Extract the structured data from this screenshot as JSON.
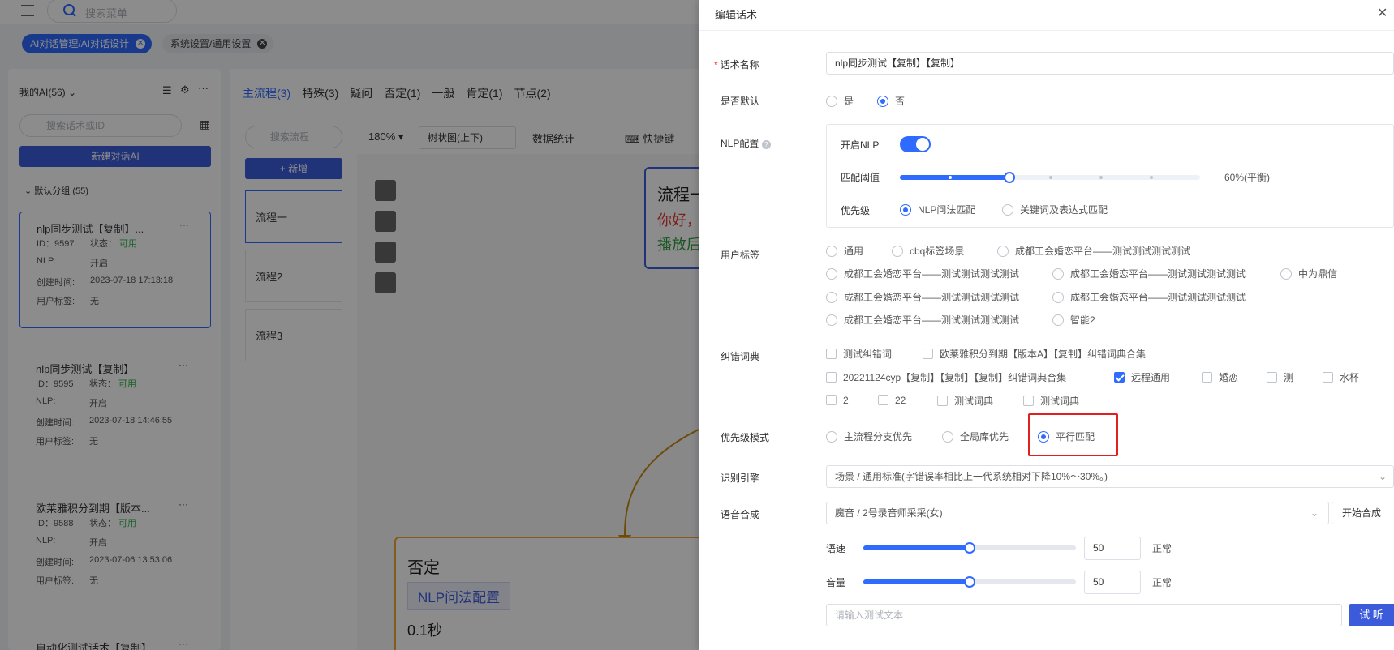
{
  "background": {
    "search_menu_placeholder": "搜索菜单",
    "tags": [
      "AI对话管理/AI对话设计",
      "系统设置/通用设置"
    ],
    "my_ai": "我的AI(56)",
    "script_search_placeholder": "搜索话术或ID",
    "new_ai_button": "新建对话AI",
    "default_group": "默认分组",
    "default_group_count": "(55)",
    "cards": [
      {
        "title": "nlp同步测试【复制】...",
        "id": "ID：9597",
        "status_label": "状态：",
        "status": "可用",
        "nlp_label": "NLP:",
        "nlp": "开启",
        "created_label": "创建时间:",
        "created": "2023-07-18 17:13:18",
        "tag_label": "用户标签:",
        "tag": "无"
      },
      {
        "title": "nlp同步测试【复制】",
        "id": "ID：9595",
        "status_label": "状态：",
        "status": "可用",
        "nlp_label": "NLP:",
        "nlp": "开启",
        "created_label": "创建时间:",
        "created": "2023-07-18 14:46:55",
        "tag_label": "用户标签:",
        "tag": "无"
      },
      {
        "title": "欧莱雅积分到期【版本...",
        "id": "ID：9588",
        "status_label": "状态：",
        "status": "可用",
        "nlp_label": "NLP:",
        "nlp": "开启",
        "created_label": "创建时间:",
        "created": "2023-07-06 13:53:06",
        "tag_label": "用户标签:",
        "tag": "无"
      },
      {
        "title": "自动化测试话术【复制】",
        "id": "",
        "status_label": "",
        "status": "",
        "nlp_label": "",
        "nlp": "",
        "created_label": "",
        "created": "",
        "tag_label": "",
        "tag": ""
      }
    ],
    "flow_tabs": [
      "主流程(3)",
      "特殊(3)",
      "疑问",
      "否定(1)",
      "一般",
      "肯定(1)",
      "节点(2)"
    ],
    "flow_search_placeholder": "搜索流程",
    "add_button": "+ 新增",
    "flows": [
      "流程一",
      "流程2",
      "流程3"
    ],
    "zoom": "180%",
    "layout_select": "树状图(上下)",
    "stats_label": "数据统计",
    "shortcut_label": "快捷键",
    "node1_title": "流程一",
    "node1_line1": "你好，",
    "node1_line2": "播放后",
    "node2_title": "否定",
    "node2_tag": "NLP问法配置",
    "node2_time": "0.1秒"
  },
  "drawer": {
    "title": "编辑话术",
    "name_label": "话术名称",
    "name_value": "nlp同步测试【复制】【复制】",
    "default_label": "是否默认",
    "default_options": [
      {
        "label": "是",
        "checked": false
      },
      {
        "label": "否",
        "checked": true
      }
    ],
    "nlp_label": "NLP配置",
    "nlp_enable_label": "开启NLP",
    "nlp_enabled": true,
    "threshold_label": "匹配阈值",
    "threshold_value": 0.6,
    "threshold_text": "60%(平衡)",
    "priority_label": "优先级",
    "priority_options": [
      {
        "label": "NLP问法匹配",
        "checked": true
      },
      {
        "label": "关键词及表达式匹配",
        "checked": false
      }
    ],
    "user_tag_label": "用户标签",
    "user_tags": [
      "通用",
      "cbq标签场景",
      "成都工会婚恋平台——测试测试测试测试",
      "成都工会婚恋平台——测试测试测试测试",
      "成都工会婚恋平台——测试测试测试测试",
      "中为鼎信",
      "成都工会婚恋平台——测试测试测试测试",
      "成都工会婚恋平台——测试测试测试测试",
      "成都工会婚恋平台——测试测试测试测试",
      "智能2"
    ],
    "dict_label": "纠错词典",
    "dicts": [
      {
        "label": "测试纠错词",
        "checked": false
      },
      {
        "label": "欧莱雅积分到期【版本A】【复制】纠错词典合集",
        "checked": false
      },
      {
        "label": "20221124cyp【复制】【复制】【复制】纠错词典合集",
        "checked": false
      },
      {
        "label": "远程通用",
        "checked": true
      },
      {
        "label": "婚恋",
        "checked": false
      },
      {
        "label": "测",
        "checked": false
      },
      {
        "label": "水杯",
        "checked": false
      },
      {
        "label": "2",
        "checked": false
      },
      {
        "label": "22",
        "checked": false
      },
      {
        "label": "测试词典",
        "checked": false
      },
      {
        "label": "测试词典",
        "checked": false
      }
    ],
    "priority_mode_label": "优先级模式",
    "priority_modes": [
      {
        "label": "主流程分支优先",
        "checked": false
      },
      {
        "label": "全局库优先",
        "checked": false
      },
      {
        "label": "平行匹配",
        "checked": true
      }
    ],
    "engine_label": "识别引擎",
    "engine_value": "场景 / 通用标准(字错误率相比上一代系统相对下降10%～30%。)",
    "tts_label": "语音合成",
    "tts_value": "魔音 / 2号录音师采采(女)",
    "tts_button": "开始合成",
    "speed_label": "语速",
    "speed_value": "50",
    "speed_level": 0.5,
    "speed_text": "正常",
    "volume_label": "音量",
    "volume_value": "50",
    "volume_level": 0.5,
    "volume_text": "正常",
    "test_placeholder": "请输入测试文本",
    "test_button": "试 听",
    "accent": "#2f6bff",
    "highlight": "#e0201e"
  }
}
